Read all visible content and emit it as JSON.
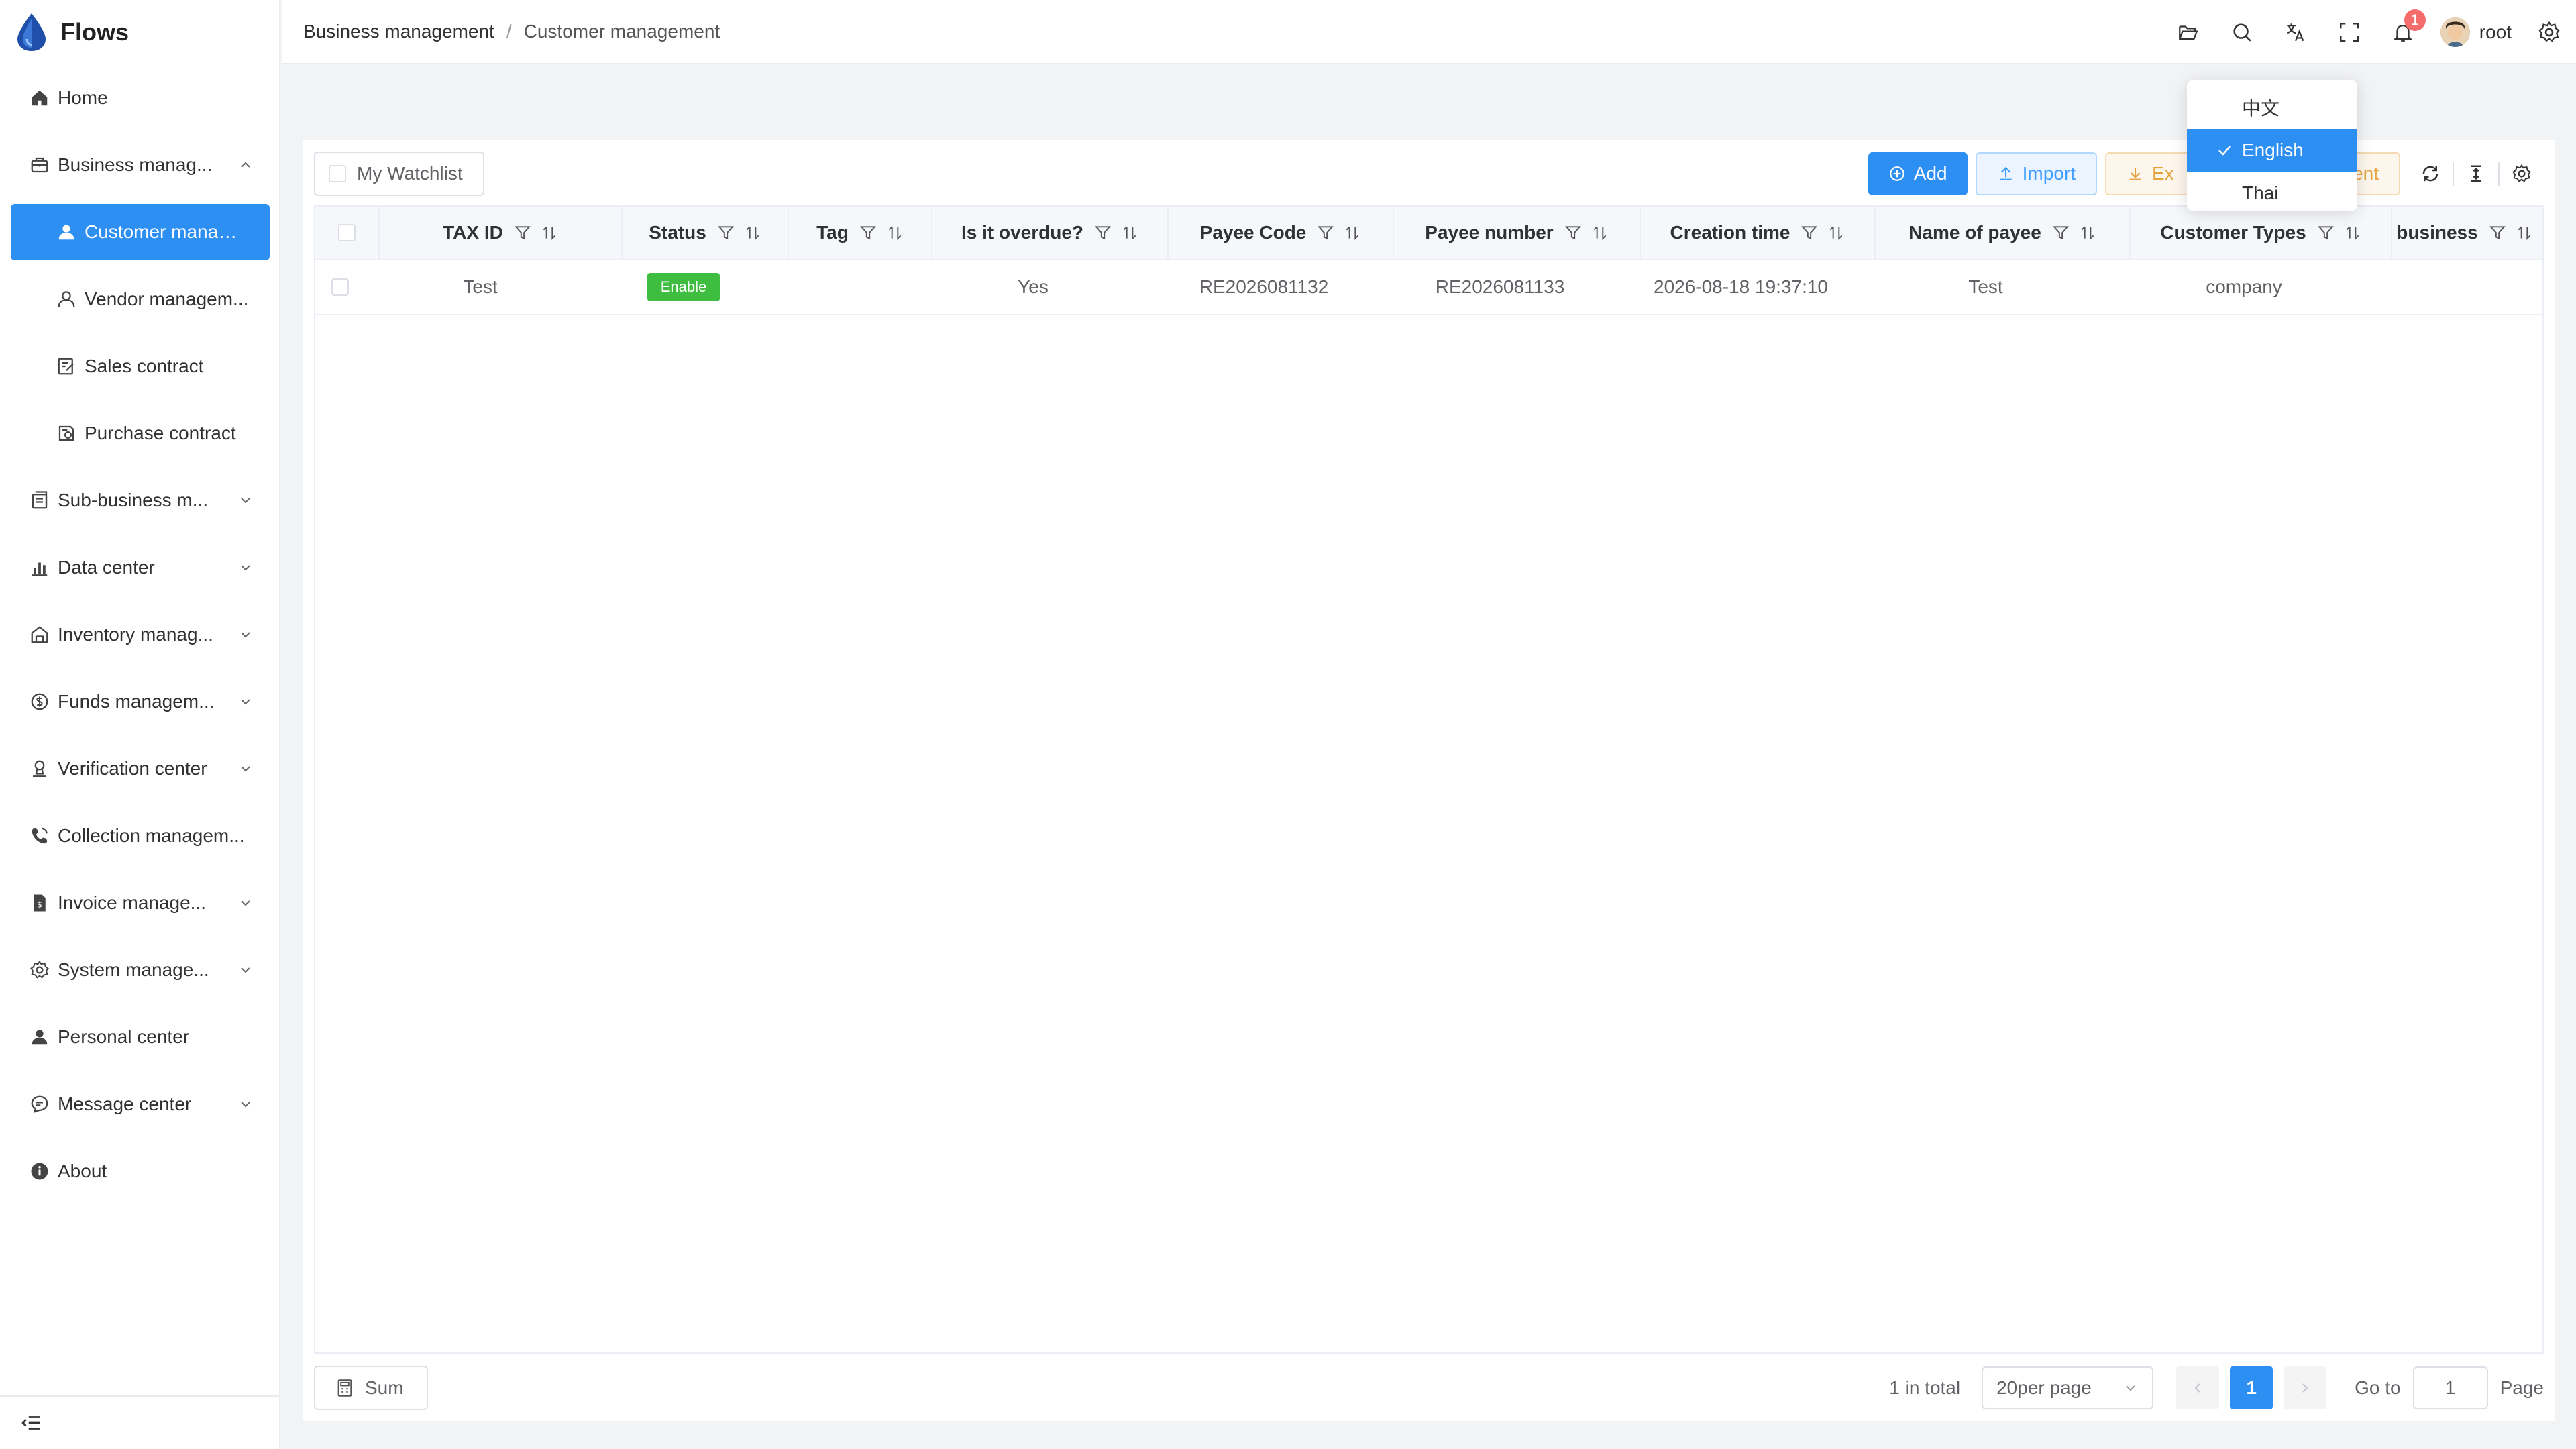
{
  "app": {
    "name": "Flows"
  },
  "sidebar": {
    "items": [
      {
        "label": "Home",
        "icon": "home-icon"
      },
      {
        "label": "Business manag...",
        "icon": "briefcase-icon",
        "expanded": true
      },
      {
        "label": "Customer manag...",
        "icon": "user-icon",
        "active": true
      },
      {
        "label": "Vendor managem...",
        "icon": "user-outline-icon"
      },
      {
        "label": "Sales contract",
        "icon": "edit-doc-icon"
      },
      {
        "label": "Purchase contract",
        "icon": "contract-icon"
      },
      {
        "label": "Sub-business m...",
        "icon": "folder-list-icon"
      },
      {
        "label": "Data center",
        "icon": "bar-chart-icon"
      },
      {
        "label": "Inventory manag...",
        "icon": "warehouse-icon"
      },
      {
        "label": "Funds managem...",
        "icon": "money-icon"
      },
      {
        "label": "Verification center",
        "icon": "verify-icon"
      },
      {
        "label": "Collection managem...",
        "icon": "phone-icon"
      },
      {
        "label": "Invoice manage...",
        "icon": "invoice-icon"
      },
      {
        "label": "System manage...",
        "icon": "gear-icon"
      },
      {
        "label": "Personal center",
        "icon": "person-icon"
      },
      {
        "label": "Message center",
        "icon": "message-icon"
      },
      {
        "label": "About",
        "icon": "info-icon"
      }
    ]
  },
  "header": {
    "breadcrumb": [
      "Business management",
      "Customer management"
    ],
    "separator": "/",
    "notification_count": "1",
    "username": "root"
  },
  "language_menu": {
    "options": [
      "中文",
      "English",
      "Thai"
    ],
    "selected": "English"
  },
  "toolbar": {
    "watchlist_label": "My Watchlist",
    "add_label": "Add",
    "import_label": "Import",
    "export_label": "Ex",
    "export_tail": "nent"
  },
  "table": {
    "columns": [
      "TAX ID",
      "Status",
      "Tag",
      "Is it overdue?",
      "Payee Code",
      "Payee number",
      "Creation time",
      "Name of payee",
      "Customer Types",
      "business"
    ],
    "rows": [
      {
        "tax_id": "Test",
        "status": "Enable",
        "tag": "",
        "overdue": "Yes",
        "payee_code": "RE2026081132",
        "payee_number": "RE2026081133",
        "creation_time": "2026-08-18 19:37:10",
        "name_of_payee": "Test",
        "customer_type": "company",
        "business": ""
      }
    ]
  },
  "footer": {
    "sum_label": "Sum",
    "total": "1 in total",
    "page_size": "20per page",
    "current_page": "1",
    "goto_label": "Go to",
    "goto_value": "1",
    "page_suffix": "Page"
  },
  "colors": {
    "accent": "#2e8ff3",
    "success": "#3fbd40",
    "badge": "#f56c6c"
  }
}
